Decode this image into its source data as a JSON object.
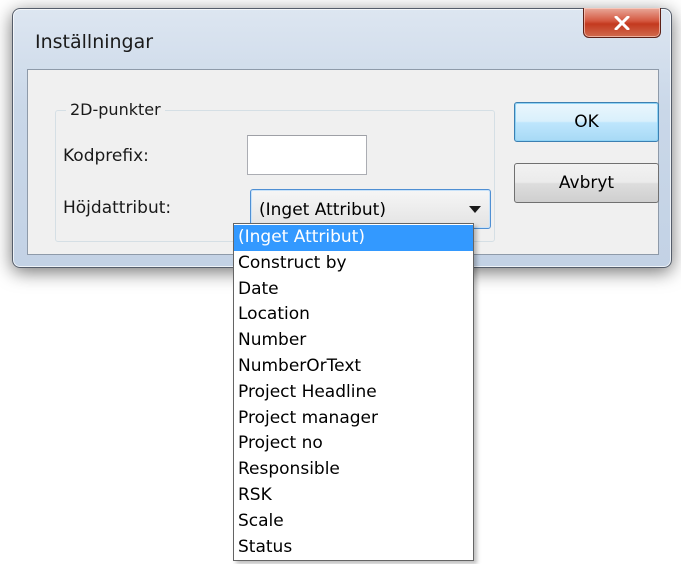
{
  "window": {
    "title": "Inställningar"
  },
  "group": {
    "label": "2D-punkter"
  },
  "fields": {
    "kodprefix_label": "Kodprefix:",
    "kodprefix_value": "",
    "hojdattribut_label": "Höjdattribut:",
    "hojdattribut_value": "(Inget Attribut)"
  },
  "buttons": {
    "ok": "OK",
    "cancel": "Avbryt"
  },
  "dropdown": {
    "items": [
      "(Inget Attribut)",
      "Construct by",
      "Date",
      "Location",
      "Number",
      "NumberOrText",
      "Project Headline",
      "Project manager",
      "Project no",
      "Responsible",
      "RSK",
      "Scale",
      "Status"
    ],
    "selected_index": 0
  },
  "colors": {
    "selection": "#3399ff",
    "close_button": "#c3391f"
  }
}
